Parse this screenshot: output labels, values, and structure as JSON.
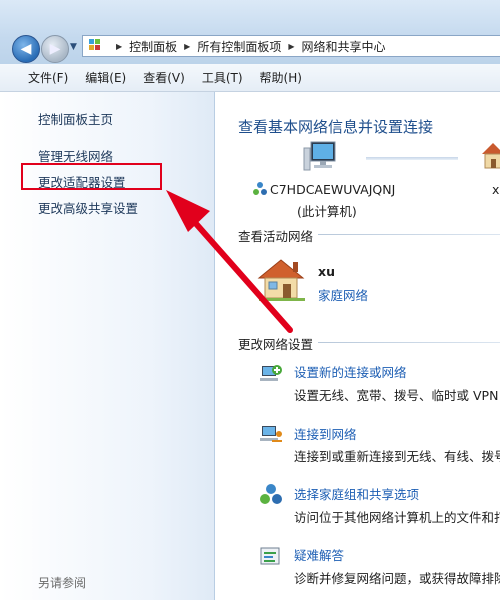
{
  "address": {
    "crumbs": [
      "控制面板",
      "所有控制面板项",
      "网络和共享中心"
    ]
  },
  "menu": [
    "文件(F)",
    "编辑(E)",
    "查看(V)",
    "工具(T)",
    "帮助(H)"
  ],
  "sidebar": {
    "home": "控制面板主页",
    "items": [
      "管理无线网络",
      "更改适配器设置",
      "更改高级共享设置"
    ],
    "see_also": "另请参阅"
  },
  "main": {
    "title": "查看基本网络信息并设置连接",
    "computer_name": "C7HDCAEWUVAJQNJ",
    "computer_sub": "(此计算机)",
    "right_label": "xu",
    "active_heading": "查看活动网络",
    "network_name": "xu",
    "network_type": "家庭网络",
    "change_heading": "更改网络设置",
    "tasks": [
      {
        "link": "设置新的连接或网络",
        "desc": "设置无线、宽带、拨号、临时或 VPN"
      },
      {
        "link": "连接到网络",
        "desc": "连接到或重新连接到无线、有线、拨号"
      },
      {
        "link": "选择家庭组和共享选项",
        "desc": "访问位于其他网络计算机上的文件和打"
      },
      {
        "link": "疑难解答",
        "desc": "诊断并修复网络问题，或获得故障排除"
      }
    ]
  },
  "colors": {
    "highlight": "#e1001c",
    "link": "#1e5fb4",
    "title": "#1e4e8c"
  }
}
